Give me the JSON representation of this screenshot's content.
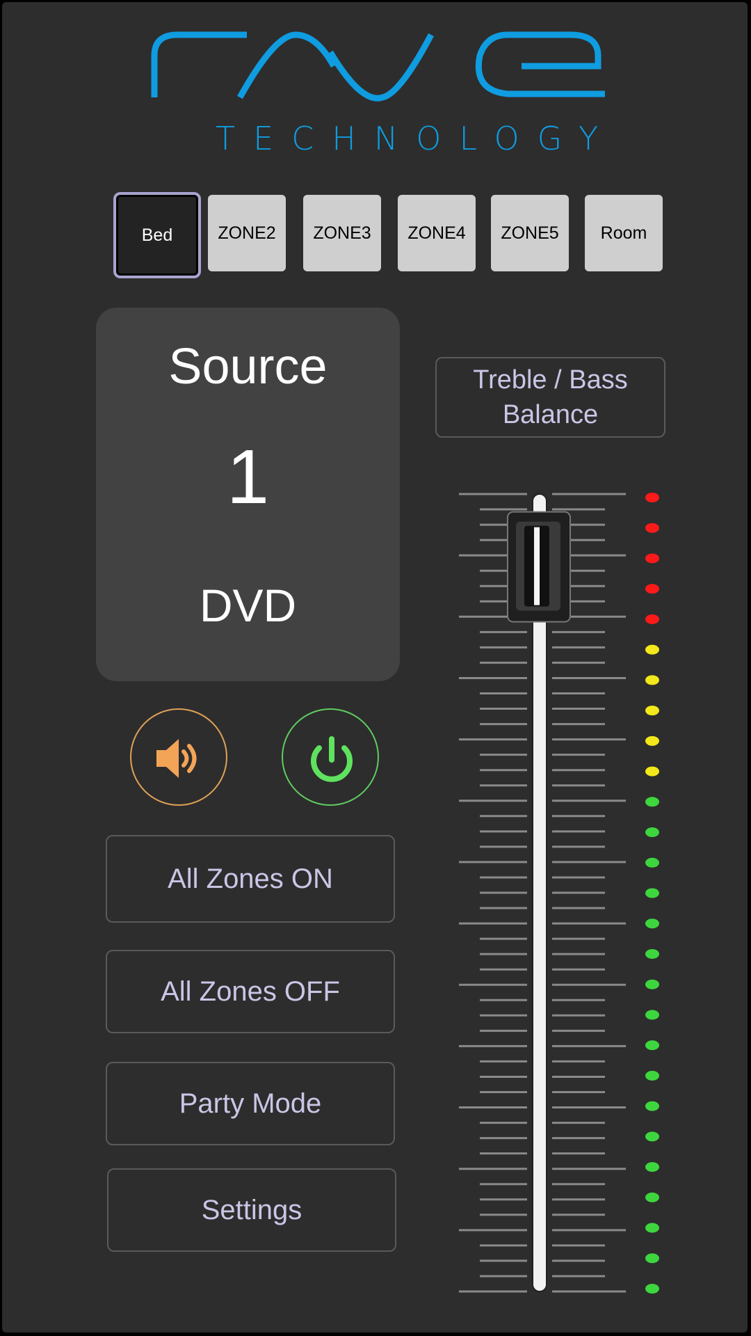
{
  "brand": {
    "logo_text": "rave",
    "tagline": "TECHNOLOGY",
    "color": "#0f9ce0"
  },
  "zones": [
    {
      "label": "Bed",
      "active": true
    },
    {
      "label": "ZONE2",
      "active": false
    },
    {
      "label": "ZONE3",
      "active": false
    },
    {
      "label": "ZONE4",
      "active": false
    },
    {
      "label": "ZONE5",
      "active": false
    },
    {
      "label": "Room",
      "active": false
    }
  ],
  "source": {
    "label": "Source",
    "number": "1",
    "name": "DVD"
  },
  "controls": {
    "mute": {
      "icon": "speaker-icon",
      "color": "#e0a257"
    },
    "power": {
      "icon": "power-icon",
      "color": "#5fcd5f"
    }
  },
  "actions": {
    "all_on": "All Zones ON",
    "all_off": "All Zones OFF",
    "party": "Party Mode",
    "settings": "Settings"
  },
  "treble_bass": {
    "line1": "Treble / Bass",
    "line2": "Balance"
  },
  "volume": {
    "level_fraction": 0.97,
    "meter": {
      "leds": 27,
      "red": 5,
      "yellow": 5,
      "green": 17
    },
    "colors": {
      "red": "#ff1a1a",
      "yellow": "#f3e81a",
      "green": "#3ed63e"
    }
  }
}
